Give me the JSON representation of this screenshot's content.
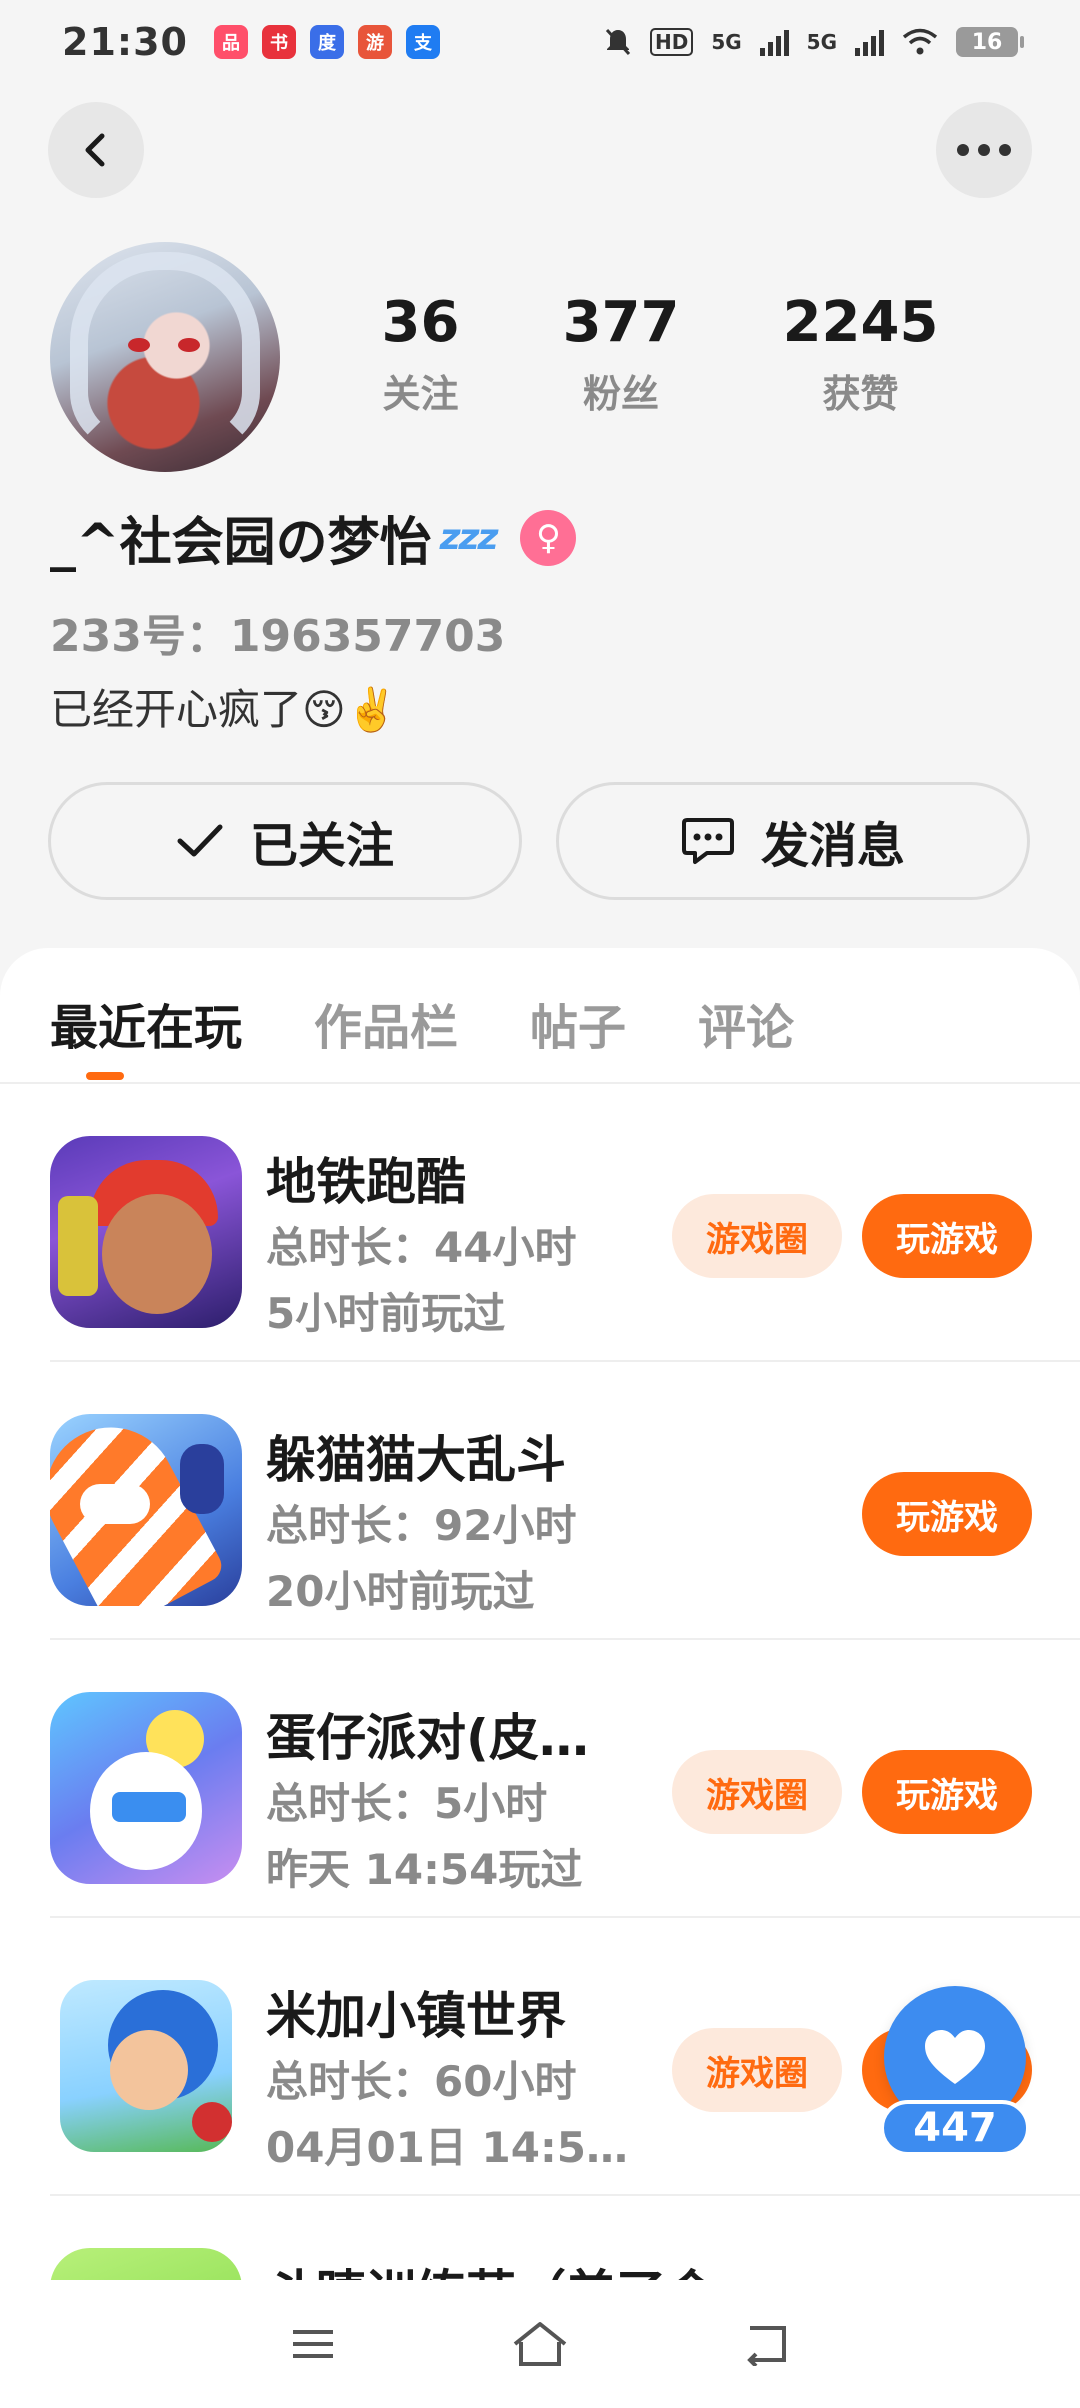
{
  "status_bar": {
    "time": "21:30",
    "apps": [
      {
        "name": "app-1",
        "color": "#ff4f6a",
        "glyph": "品"
      },
      {
        "name": "app-2",
        "color": "#e8323c",
        "glyph": "书"
      },
      {
        "name": "app-3",
        "color": "#3a6ee8",
        "glyph": "度"
      },
      {
        "name": "app-4",
        "color": "#e8553a",
        "glyph": "游"
      },
      {
        "name": "app-5",
        "color": "#1f7cf2",
        "glyph": "支"
      }
    ],
    "network": "5G",
    "network2": "5G",
    "battery": "16"
  },
  "profile": {
    "stats": [
      {
        "value": "36",
        "label": "关注"
      },
      {
        "value": "377",
        "label": "粉丝"
      },
      {
        "value": "2245",
        "label": "获赞"
      }
    ],
    "username": "_^社会园の梦怡",
    "zzz": "zzz",
    "gender_symbol": "♀",
    "user_id": "233号：196357703",
    "bio": "已经开心疯了😚✌️",
    "follow_label": "已关注",
    "message_label": "发消息"
  },
  "tabs": [
    {
      "label": "最近在玩",
      "active": true
    },
    {
      "label": "作品栏",
      "active": false
    },
    {
      "label": "帖子",
      "active": false
    },
    {
      "label": "评论",
      "active": false
    }
  ],
  "games": [
    {
      "name": "地铁跑酷",
      "duration": "总时长：44小时",
      "last_played": "5小时前玩过",
      "circle_label": "游戏圈",
      "play_label": "玩游戏"
    },
    {
      "name": "躲猫猫大乱斗",
      "duration": "总时长：92小时",
      "last_played": "20小时前玩过",
      "play_label": "玩游戏"
    },
    {
      "name": "蛋仔派对(皮…",
      "duration": "总时长：5小时",
      "last_played": "昨天 14:54玩过",
      "circle_label": "游戏圈",
      "play_label": "玩游戏"
    },
    {
      "name": "米加小镇世界",
      "duration": "总时长：60小时",
      "last_played": "04月01日 14:5…",
      "circle_label": "游戏圈"
    },
    {
      "name": "斗睫训练营（美了会…"
    }
  ],
  "floating_like": {
    "count": "447"
  },
  "colors": {
    "accent": "#ff6a10",
    "like_blue": "#3d8cf0",
    "gender_pink": "#ff6f95"
  }
}
